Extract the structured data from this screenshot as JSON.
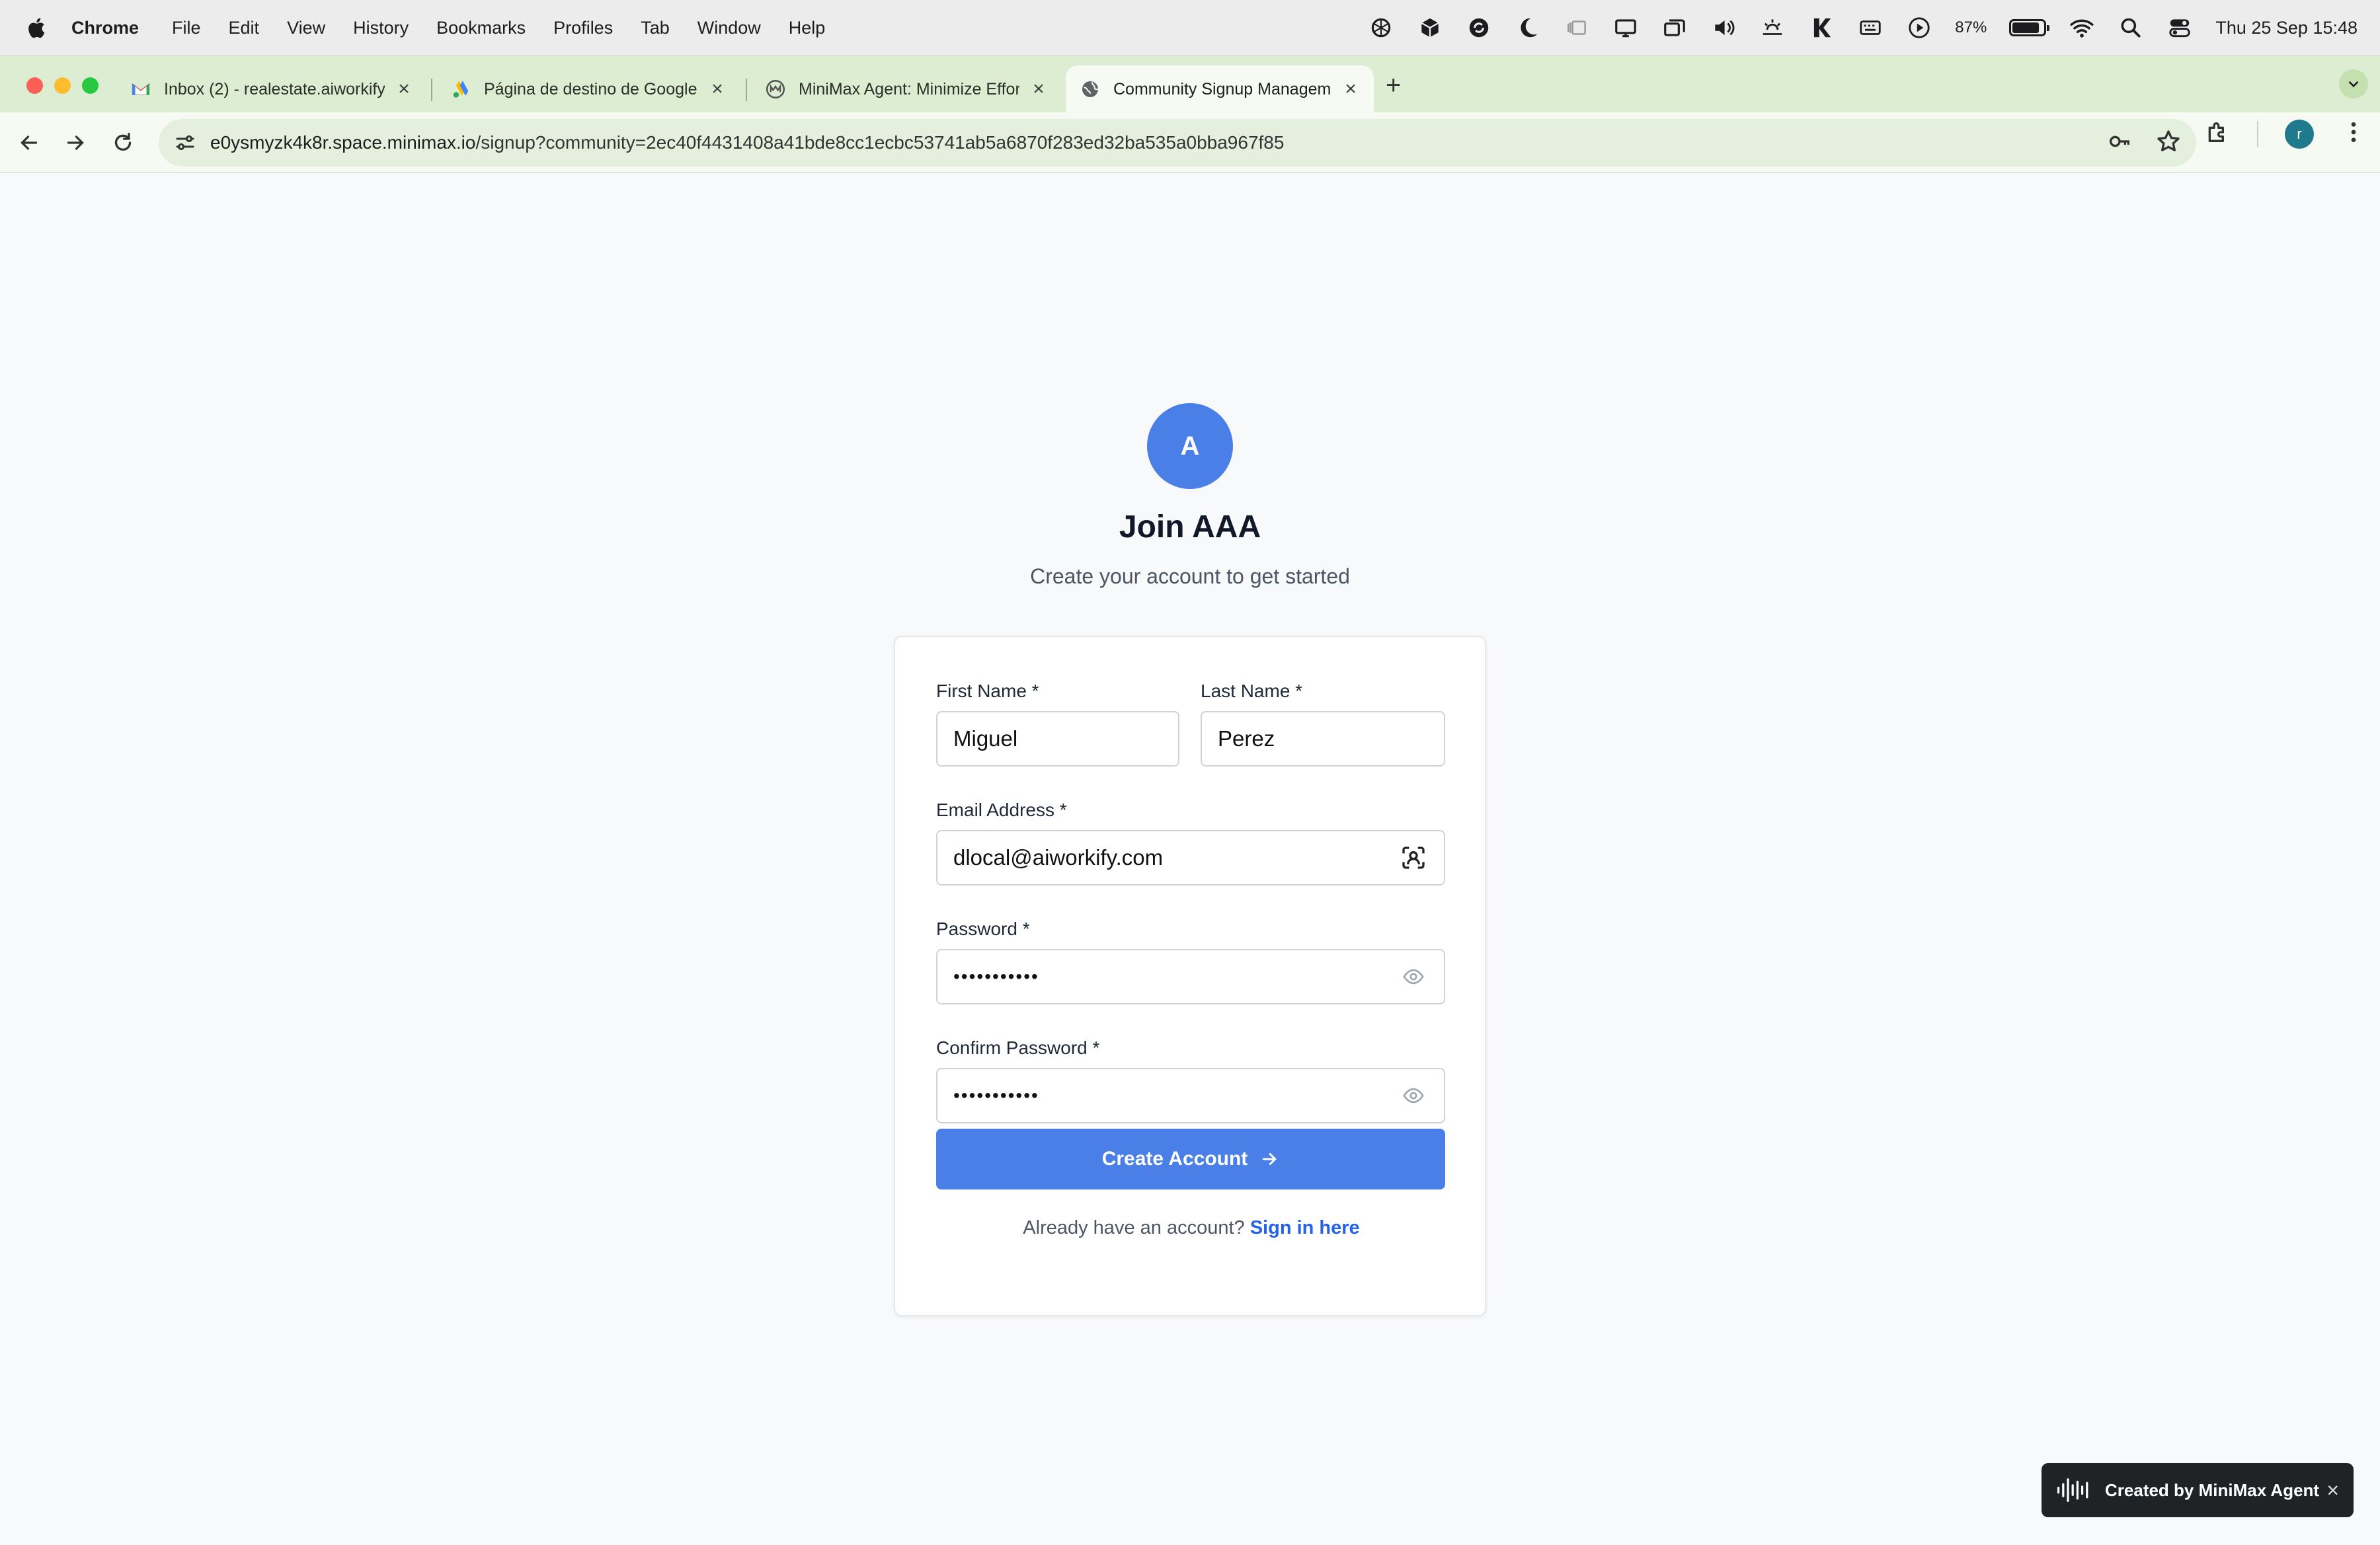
{
  "menubar": {
    "app": "Chrome",
    "items": [
      "File",
      "Edit",
      "View",
      "History",
      "Bookmarks",
      "Profiles",
      "Tab",
      "Window",
      "Help"
    ],
    "battery": "87%",
    "battery_level": 0.87,
    "clock": "Thu 25 Sep  15:48"
  },
  "tabs": [
    {
      "title": "Inbox (2) - realestate.aiworkify",
      "icon": "gmail-icon",
      "active": false
    },
    {
      "title": "Página de destino de Google",
      "icon": "google-ads-icon",
      "active": false
    },
    {
      "title": "MiniMax Agent: Minimize Effort",
      "icon": "minimax-icon",
      "active": false
    },
    {
      "title": "Community Signup Management",
      "icon": "globe-icon",
      "active": true
    }
  ],
  "address": {
    "host": "e0ysmyzk4k8r.space.minimax.io",
    "path": "/signup?community=2ec40f4431408a41bde8cc1ecbc53741ab5a6870f283ed32ba535a0bba967f85"
  },
  "profile_initial": "r",
  "signup": {
    "logo_letter": "A",
    "title": "Join AAA",
    "subtitle": "Create your account to get started",
    "first_name_label": "First Name *",
    "first_name_value": "Miguel",
    "last_name_label": "Last Name *",
    "last_name_value": "Perez",
    "email_label": "Email Address *",
    "email_value": "dlocal@aiworkify.com",
    "password_label": "Password *",
    "password_value": "•••••••••••",
    "confirm_label": "Confirm Password *",
    "confirm_value": "•••••••••••",
    "submit_label": "Create Account",
    "signin_prompt": "Already have an account?",
    "signin_link": "Sign in here"
  },
  "badge": {
    "label": "Created by MiniMax Agent"
  },
  "colors": {
    "accent": "#4a7fe8",
    "link": "#2563eb",
    "tabstrip": "#dcedd1"
  }
}
